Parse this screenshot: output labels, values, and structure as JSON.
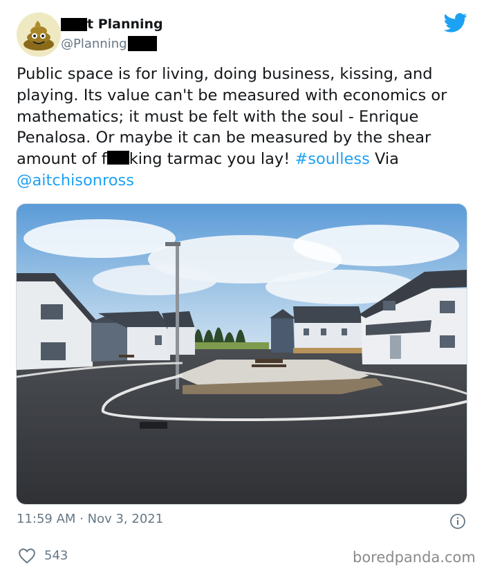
{
  "author": {
    "name_suffix": "t Planning",
    "handle": "@Planning",
    "avatar_icon": "poop-emoji-icon"
  },
  "brand_icon": "twitter-bird-icon",
  "tweet": {
    "text_parts": {
      "p1": "Public space is for living, doing business, kissing, and playing. Its value can't be measured with economics or mathematics; it must be felt with the soul - Enrique Penalosa. Or maybe it can be measured by the shear amount of f",
      "p2": "king tarmac you lay! ",
      "hashtag": "#soulless",
      "via": " Via ",
      "mention": "@aitchisonross"
    },
    "link_color": "#1da1f2"
  },
  "meta": {
    "time": "11:59 AM",
    "separator": " · ",
    "date": "Nov 3, 2021",
    "info_icon": "info-icon"
  },
  "engagement": {
    "like_icon": "heart-icon",
    "likes": "543"
  },
  "watermark": "boredpanda.com"
}
